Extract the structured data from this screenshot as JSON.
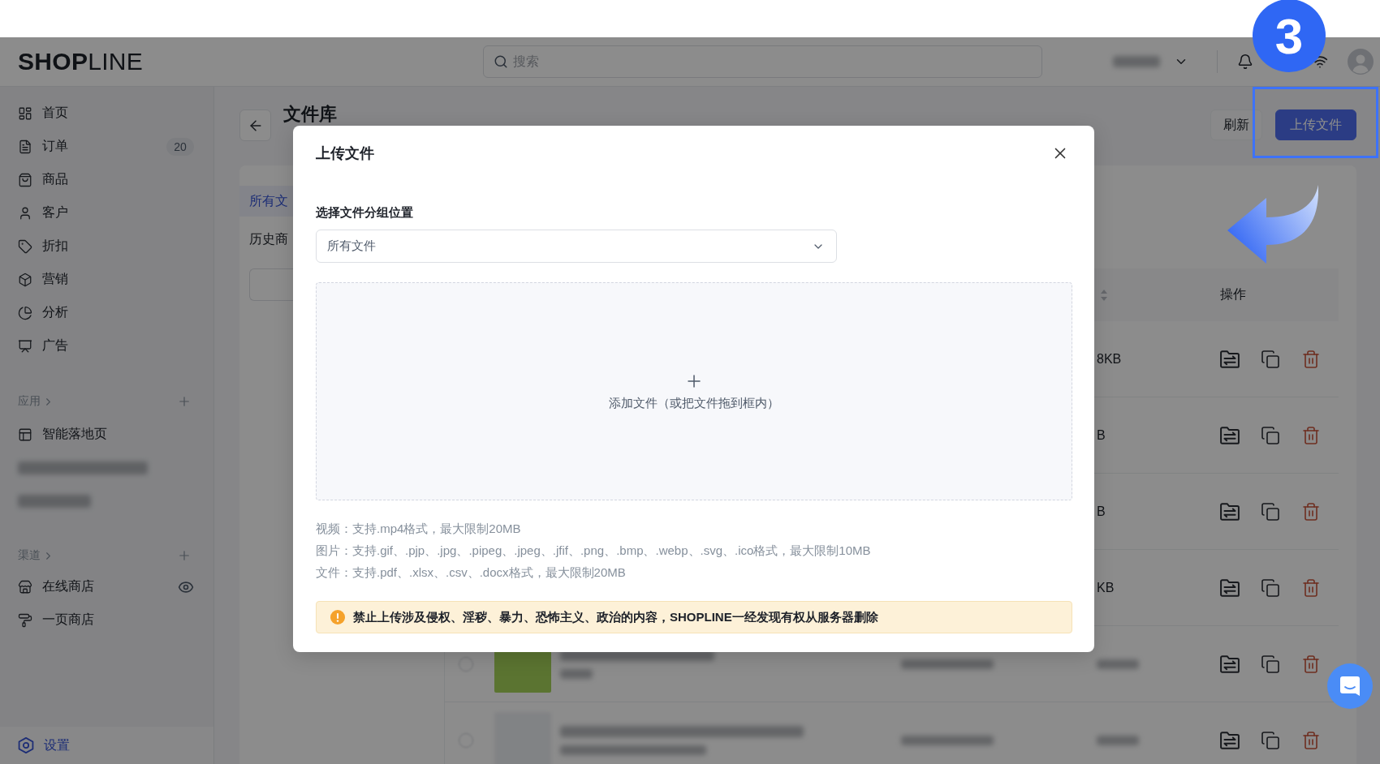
{
  "header": {
    "logo": "**SHOP**LINE",
    "search": {
      "placeholder": "搜索"
    }
  },
  "sidebar": {
    "items": [
      {
        "label": "首页",
        "selected": false
      },
      {
        "label": "订单",
        "badge": "20",
        "selected": false
      },
      {
        "label": "商品",
        "selected": false
      },
      {
        "label": "客户",
        "selected": false
      },
      {
        "label": "折扣",
        "selected": false
      },
      {
        "label": "营销",
        "selected": false
      },
      {
        "label": "分析",
        "selected": false
      },
      {
        "label": "广告",
        "selected": false
      }
    ],
    "sections": [
      {
        "title": "应用",
        "items": [
          {
            "kind": "link",
            "label": "智能落地页",
            "selected": false
          },
          {
            "kind": "redacted"
          },
          {
            "kind": "redacted"
          }
        ]
      },
      {
        "title": "渠道",
        "items": [
          {
            "kind": "link",
            "label": "在线商店",
            "selected": false
          },
          {
            "kind": "link",
            "label": "一页商店",
            "selected": false
          }
        ]
      }
    ],
    "footer_item": {
      "label": "设置",
      "selected": true
    }
  },
  "page": {
    "title": "文件库",
    "buttons": [
      {
        "kind": "secondary",
        "label": "刷新"
      },
      {
        "kind": "primary",
        "label": "上传文件"
      }
    ],
    "groups": [
      {
        "label": "所有文",
        "selected": true
      },
      {
        "label": "历史商",
        "selected": false
      }
    ],
    "table": {
      "actions_header": "操作",
      "rows": [
        {
          "kind": "visible",
          "column_5": "8KB"
        },
        {
          "kind": "visible",
          "column_5": "B"
        },
        {
          "kind": "visible",
          "column_5": "B"
        },
        {
          "kind": "visible",
          "column_5": "KB"
        },
        {
          "kind": "blurred",
          "thumbnail": {
            "kind": "block"
          },
          "checked": false
        },
        {
          "kind": "blurred",
          "thumbnail": {
            "kind": "photo"
          },
          "checked": false
        }
      ]
    }
  },
  "dialog": {
    "title": "上传文件",
    "group_label": "选择文件分组位置",
    "group_select": {
      "value": "所有文件"
    },
    "dropzone": {
      "text": "添加文件（或把文件拖到框内）"
    },
    "hints": [
      "视频：支持.mp4格式，最大限制20MB",
      "图片：支持.gif、.pjp、.jpg、.pipeg、.jpeg、.jfif、.png、.bmp、.webp、.svg、.ico格式，最大限制10MB",
      "文件：支持.pdf、.xlsx、.csv、.docx格式，最大限制20MB"
    ],
    "warning": "禁止上传涉及侵权、淫秽、暴力、恐怖主义、政治的内容，SHOPLINE一经发现有权从服务器删除"
  },
  "annotation": {
    "step": "3"
  }
}
